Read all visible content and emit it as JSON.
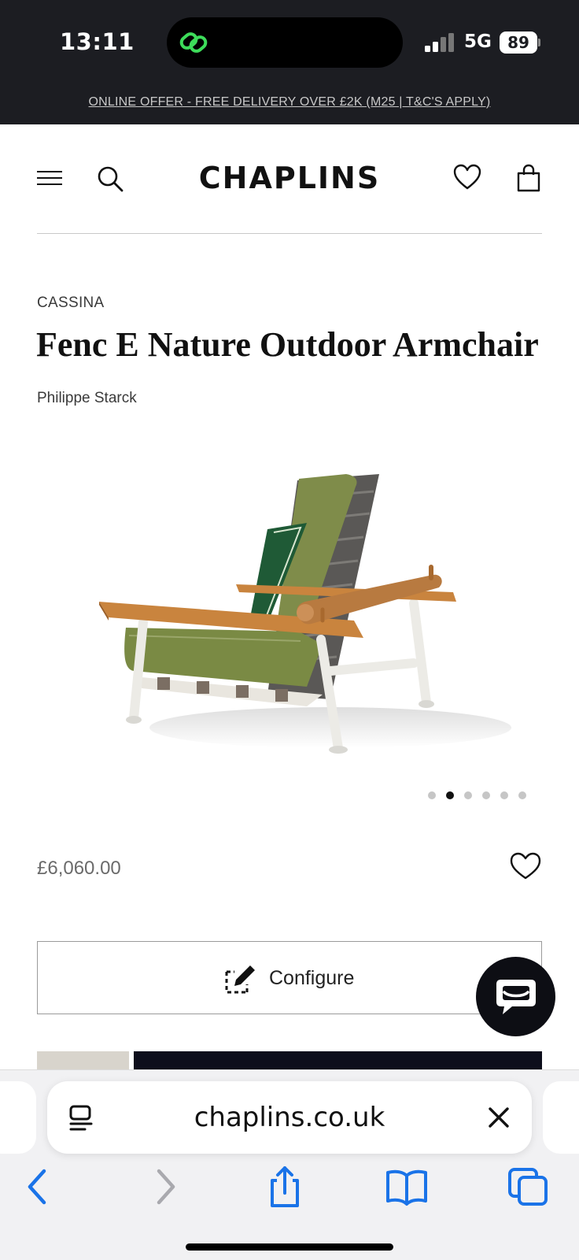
{
  "status_bar": {
    "time": "13:11",
    "network": "5G",
    "battery": "89",
    "island_app_icon": "link-icon",
    "accent_color": "#3ddc5a"
  },
  "offer_banner": {
    "text": "ONLINE OFFER - FREE DELIVERY OVER £2K (M25 | T&C'S APPLY)"
  },
  "header": {
    "menu_icon": "hamburger-menu-icon",
    "search_icon": "search-icon",
    "logo": "CHAPLINS",
    "wishlist_icon": "heart-icon",
    "bag_icon": "shopping-bag-icon"
  },
  "product": {
    "brand": "CASSINA",
    "title": "Fenc E Nature Outdoor Armchair",
    "designer": "Philippe Starck",
    "image_alt_icon": "armchair-photo",
    "carousel": {
      "total": 6,
      "active_index": 1
    },
    "price": "£6,060.00",
    "wishlist_icon": "heart-outline-icon"
  },
  "actions": {
    "configure_label": "Configure",
    "configure_icon": "edit-dashed-icon",
    "chat_icon": "chat-bubble-icon"
  },
  "browser": {
    "url": "chaplins.co.uk",
    "reader_icon": "reader-icon",
    "close_icon": "close-icon",
    "toolbar": [
      "back-icon",
      "forward-icon",
      "share-icon",
      "bookmarks-icon",
      "tabs-icon"
    ],
    "tint_color": "#1a73e8"
  }
}
